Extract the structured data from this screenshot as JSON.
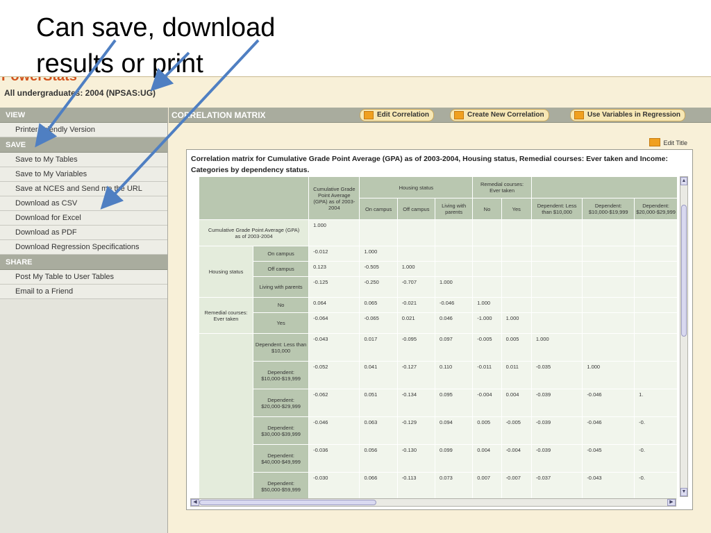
{
  "callout": {
    "line1": "Can save, download",
    "line2": "results or print"
  },
  "app": {
    "brand": "PowerStats",
    "dataset_title": "All undergraduates: 2004 (NPSAS:UG)"
  },
  "sidebar": {
    "view": {
      "header": "VIEW",
      "items": [
        "Printer-Friendly Version"
      ]
    },
    "save": {
      "header": "SAVE",
      "items": [
        "Save to My Tables",
        "Save to My Variables",
        "Save at NCES and Send me the URL",
        "Download as CSV",
        "Download for Excel",
        "Download as PDF",
        "Download Regression Specifications"
      ]
    },
    "share": {
      "header": "SHARE",
      "items": [
        "Post My Table to User Tables",
        "Email to a Friend"
      ]
    }
  },
  "main": {
    "title": "CORRELATION MATRIX",
    "buttons": {
      "edit": "Edit Correlation",
      "create": "Create New Correlation",
      "use": "Use Variables in Regression"
    },
    "edit_title": "Edit Title",
    "caption": "Correlation matrix for Cumulative Grade Point Average (GPA) as of 2003-2004, Housing status, Remedial courses: Ever taken and Income: Categories by dependency status."
  },
  "table": {
    "group_headers": {
      "gpa": "Cumulative Grade Point Average (GPA) as of 2003-2004",
      "housing": "Housing status",
      "remedial": "Remedial courses: Ever taken"
    },
    "columns": [
      "Cumulative Grade Point Average (GPA) as of 2003-2004",
      "On campus",
      "Off campus",
      "Living with parents",
      "No",
      "Yes",
      "Dependent: Less than $10,000",
      "Dependent: $10,000-$19,999",
      "Dependent: $20,000-$29,999"
    ],
    "row_groups": {
      "gpa": "Cumulative Grade Point Average (GPA) as of 2003-2004",
      "housing": "Housing status",
      "remedial": "Remedial courses: Ever taken"
    },
    "rows": [
      {
        "label": "On campus",
        "values": [
          "-0.012",
          "1.000",
          "",
          "",
          "",
          "",
          "",
          "",
          ""
        ]
      },
      {
        "label": "Off campus",
        "values": [
          "0.123",
          "-0.505",
          "1.000",
          "",
          "",
          "",
          "",
          "",
          ""
        ]
      },
      {
        "label": "Living with parents",
        "values": [
          "-0.125",
          "-0.250",
          "-0.707",
          "1.000",
          "",
          "",
          "",
          "",
          ""
        ]
      },
      {
        "label": "No",
        "values": [
          "0.064",
          "0.065",
          "-0.021",
          "-0.046",
          "1.000",
          "",
          "",
          "",
          ""
        ]
      },
      {
        "label": "Yes",
        "values": [
          "-0.064",
          "-0.065",
          "0.021",
          "0.046",
          "-1.000",
          "1.000",
          "",
          "",
          ""
        ]
      },
      {
        "label": "Dependent: Less than $10,000",
        "values": [
          "-0.043",
          "0.017",
          "-0.095",
          "0.097",
          "-0.005",
          "0.005",
          "1.000",
          "",
          ""
        ]
      },
      {
        "label": "Dependent: $10,000-$19,999",
        "values": [
          "-0.052",
          "0.041",
          "-0.127",
          "0.110",
          "-0.011",
          "0.011",
          "-0.035",
          "1.000",
          ""
        ]
      },
      {
        "label": "Dependent: $20,000-$29,999",
        "values": [
          "-0.062",
          "0.051",
          "-0.134",
          "0.095",
          "-0.004",
          "0.004",
          "-0.039",
          "-0.046",
          "1."
        ]
      },
      {
        "label": "Dependent: $30,000-$39,999",
        "values": [
          "-0.046",
          "0.063",
          "-0.129",
          "0.094",
          "0.005",
          "-0.005",
          "-0.039",
          "-0.046",
          "-0."
        ]
      },
      {
        "label": "Dependent: $40,000-$49,999",
        "values": [
          "-0.036",
          "0.056",
          "-0.130",
          "0.099",
          "0.004",
          "-0.004",
          "-0.039",
          "-0.045",
          "-0."
        ]
      },
      {
        "label": "Dependent: $50,000-$59,999",
        "values": [
          "-0.030",
          "0.066",
          "-0.113",
          "0.073",
          "0.007",
          "-0.007",
          "-0.037",
          "-0.043",
          "-0."
        ]
      }
    ],
    "gpa_self_value": "1.000"
  },
  "colors": {
    "arrow": "#4f7fc2",
    "brand": "#d2541e",
    "header_bar": "#a9ac9e",
    "cell_header": "#b9c7b0",
    "cell_value": "#e4ecdc",
    "cell_empty": "#f1f5ec"
  }
}
